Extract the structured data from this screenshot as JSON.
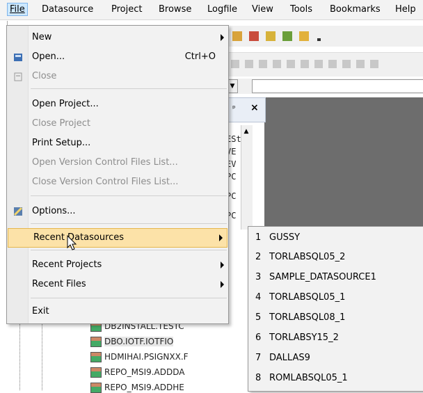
{
  "menubar": {
    "items": [
      {
        "label": "File",
        "key": "F"
      },
      {
        "label": "Datasource",
        "key": "D"
      },
      {
        "label": "Project",
        "key": "P"
      },
      {
        "label": "Browse",
        "key": "B"
      },
      {
        "label": "Logfile",
        "key": "L"
      },
      {
        "label": "View",
        "key": "V"
      },
      {
        "label": "Tools",
        "key": "T"
      },
      {
        "label": "Bookmarks",
        "key": "k"
      },
      {
        "label": "Help",
        "key": "H"
      }
    ]
  },
  "file_menu": {
    "new": "New",
    "open": "Open...",
    "open_shortcut": "Ctrl+O",
    "close": "Close",
    "open_project": "Open Project...",
    "close_project": "Close Project",
    "print_setup": "Print Setup...",
    "open_vc": "Open Version Control Files List...",
    "close_vc": "Close Version Control Files List...",
    "options": "Options...",
    "recent_datasources": "Recent Datasources",
    "recent_projects": "Recent Projects",
    "recent_files": "Recent Files",
    "exit": "Exit"
  },
  "recent_datasources": [
    {
      "num": "1",
      "name": "GUSSY"
    },
    {
      "num": "2",
      "name": "TORLABSQL05_2"
    },
    {
      "num": "3",
      "name": "SAMPLE_DATASOURCE1"
    },
    {
      "num": "4",
      "name": "TORLABSQL05_1"
    },
    {
      "num": "5",
      "name": "TORLABSQL08_1"
    },
    {
      "num": "6",
      "name": "TORLABSY15_2"
    },
    {
      "num": "7",
      "name": "DALLAS9"
    },
    {
      "num": "8",
      "name": "ROMLABSQL05_1"
    }
  ],
  "panel": {
    "pin": "ᵖ",
    "close": "×"
  },
  "tree_fragments": [
    "ESt",
    "VE",
    "EV",
    "PC",
    "PC",
    "PC"
  ],
  "tree_rows": [
    {
      "label": "DB2INSTALL.TESTC",
      "selected": false
    },
    {
      "label": "DBO.IOTF.IOTFIO",
      "selected": true
    },
    {
      "label": "HDMIHAI.PSIGNXX.F",
      "selected": false
    },
    {
      "label": "REPO_MSI9.ADDDA",
      "selected": false
    },
    {
      "label": "REPO_MSI9.ADDHE",
      "selected": false
    }
  ],
  "colors": {
    "highlight": "#fce2a8",
    "menu_bg": "#f2f2f2",
    "disabled": "#8d8d8d"
  }
}
